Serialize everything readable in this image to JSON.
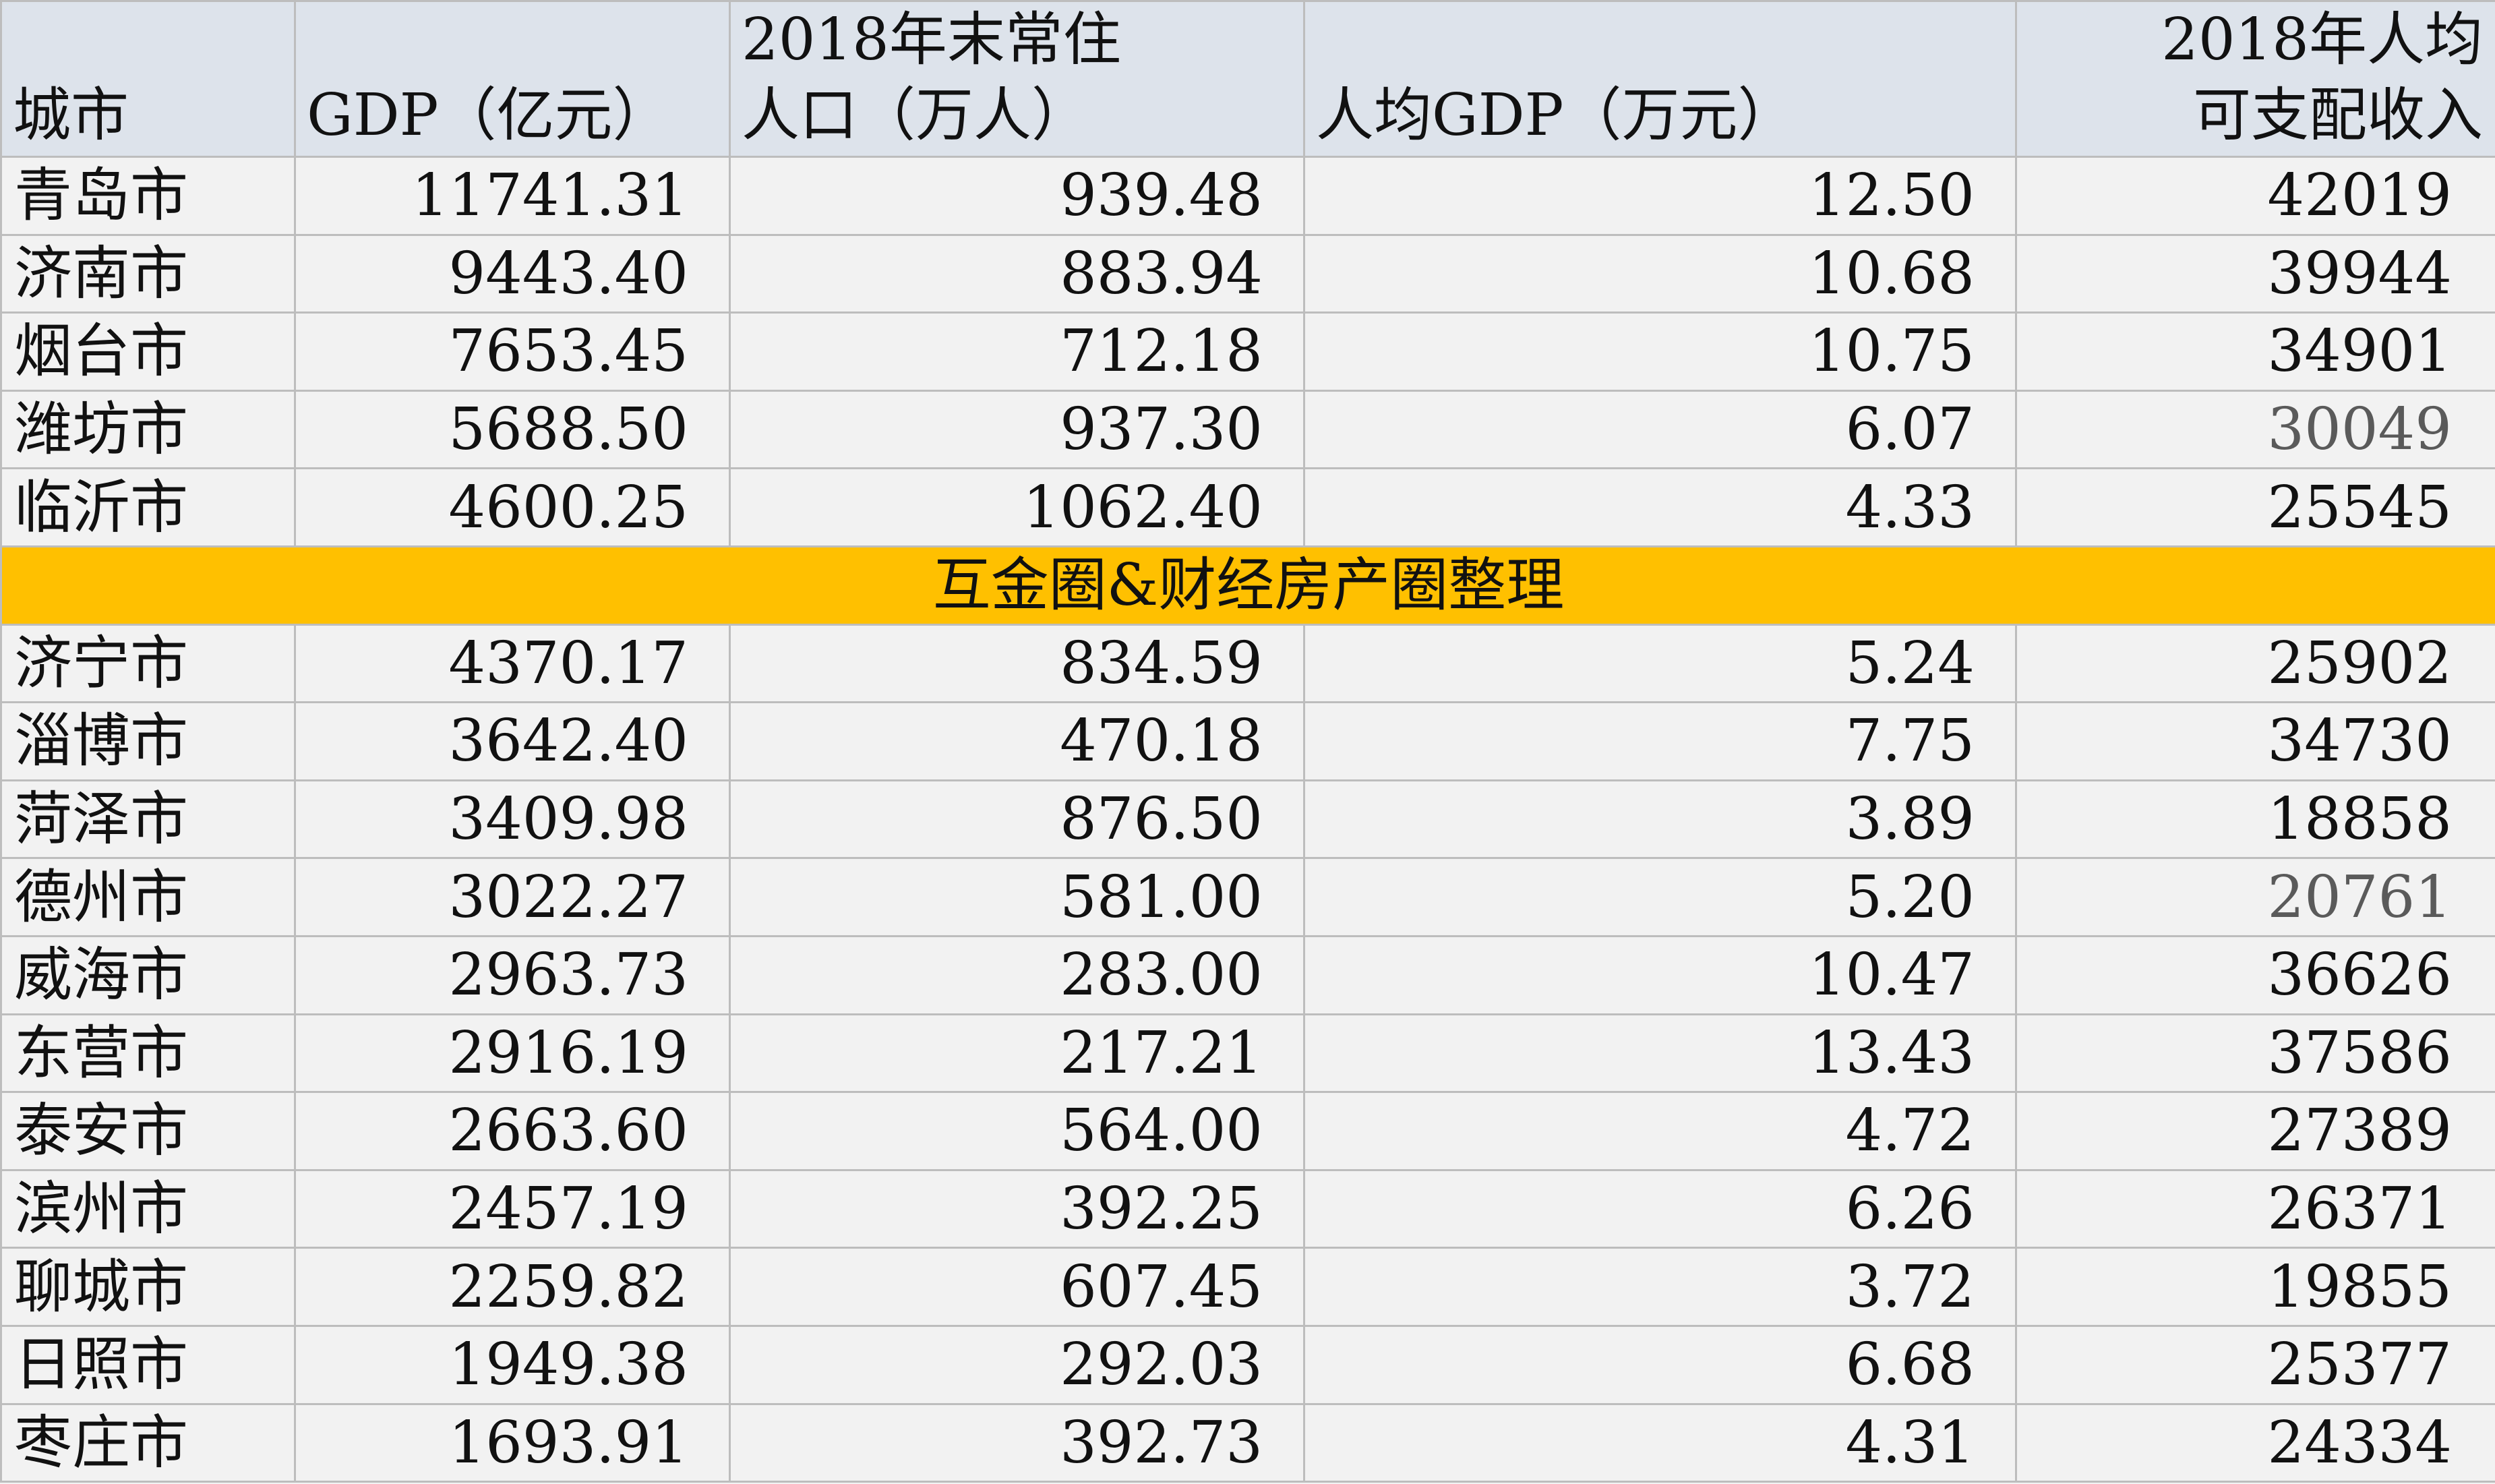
{
  "headers": {
    "city": "城市",
    "gdp": "GDP（亿元）",
    "population_line1": "2018年末常住",
    "population_line2": "人口（万人）",
    "gdp_per_capita": "人均GDP（万元）",
    "income_line1": "2018年人均",
    "income_line2": "可支配收入"
  },
  "rows": [
    {
      "city": "青岛市",
      "gdp": "11741.31",
      "population": "939.48",
      "gdp_per_capita": "12.50",
      "income": "42019"
    },
    {
      "city": "济南市",
      "gdp": "9443.40",
      "population": "883.94",
      "gdp_per_capita": "10.68",
      "income": "39944"
    },
    {
      "city": "烟台市",
      "gdp": "7653.45",
      "population": "712.18",
      "gdp_per_capita": "10.75",
      "income": "34901"
    },
    {
      "city": "潍坊市",
      "gdp": "5688.50",
      "population": "937.30",
      "gdp_per_capita": "6.07",
      "income": "30049"
    },
    {
      "city": "临沂市",
      "gdp": "4600.25",
      "population": "1062.40",
      "gdp_per_capita": "4.33",
      "income": "25545"
    },
    {
      "city": "济宁市",
      "gdp": "4370.17",
      "population": "834.59",
      "gdp_per_capita": "5.24",
      "income": "25902"
    },
    {
      "city": "淄博市",
      "gdp": "3642.40",
      "population": "470.18",
      "gdp_per_capita": "7.75",
      "income": "34730"
    },
    {
      "city": "菏泽市",
      "gdp": "3409.98",
      "population": "876.50",
      "gdp_per_capita": "3.89",
      "income": "18858"
    },
    {
      "city": "德州市",
      "gdp": "3022.27",
      "population": "581.00",
      "gdp_per_capita": "5.20",
      "income": "20761"
    },
    {
      "city": "威海市",
      "gdp": "2963.73",
      "population": "283.00",
      "gdp_per_capita": "10.47",
      "income": "36626"
    },
    {
      "city": "东营市",
      "gdp": "2916.19",
      "population": "217.21",
      "gdp_per_capita": "13.43",
      "income": "37586"
    },
    {
      "city": "泰安市",
      "gdp": "2663.60",
      "population": "564.00",
      "gdp_per_capita": "4.72",
      "income": "27389"
    },
    {
      "city": "滨州市",
      "gdp": "2457.19",
      "population": "392.25",
      "gdp_per_capita": "6.26",
      "income": "26371"
    },
    {
      "city": "聊城市",
      "gdp": "2259.82",
      "population": "607.45",
      "gdp_per_capita": "3.72",
      "income": "19855"
    },
    {
      "city": "日照市",
      "gdp": "1949.38",
      "population": "292.03",
      "gdp_per_capita": "6.68",
      "income": "25377"
    },
    {
      "city": "枣庄市",
      "gdp": "1693.91",
      "population": "392.73",
      "gdp_per_capita": "4.31",
      "income": "24334"
    }
  ],
  "banner": {
    "text": "互金圈&财经房产圈整理",
    "color": "#ffc000"
  },
  "colors": {
    "header_bg": "#dde3eb",
    "cell_bg": "#f2f2f2",
    "border": "#bdbdbd"
  }
}
